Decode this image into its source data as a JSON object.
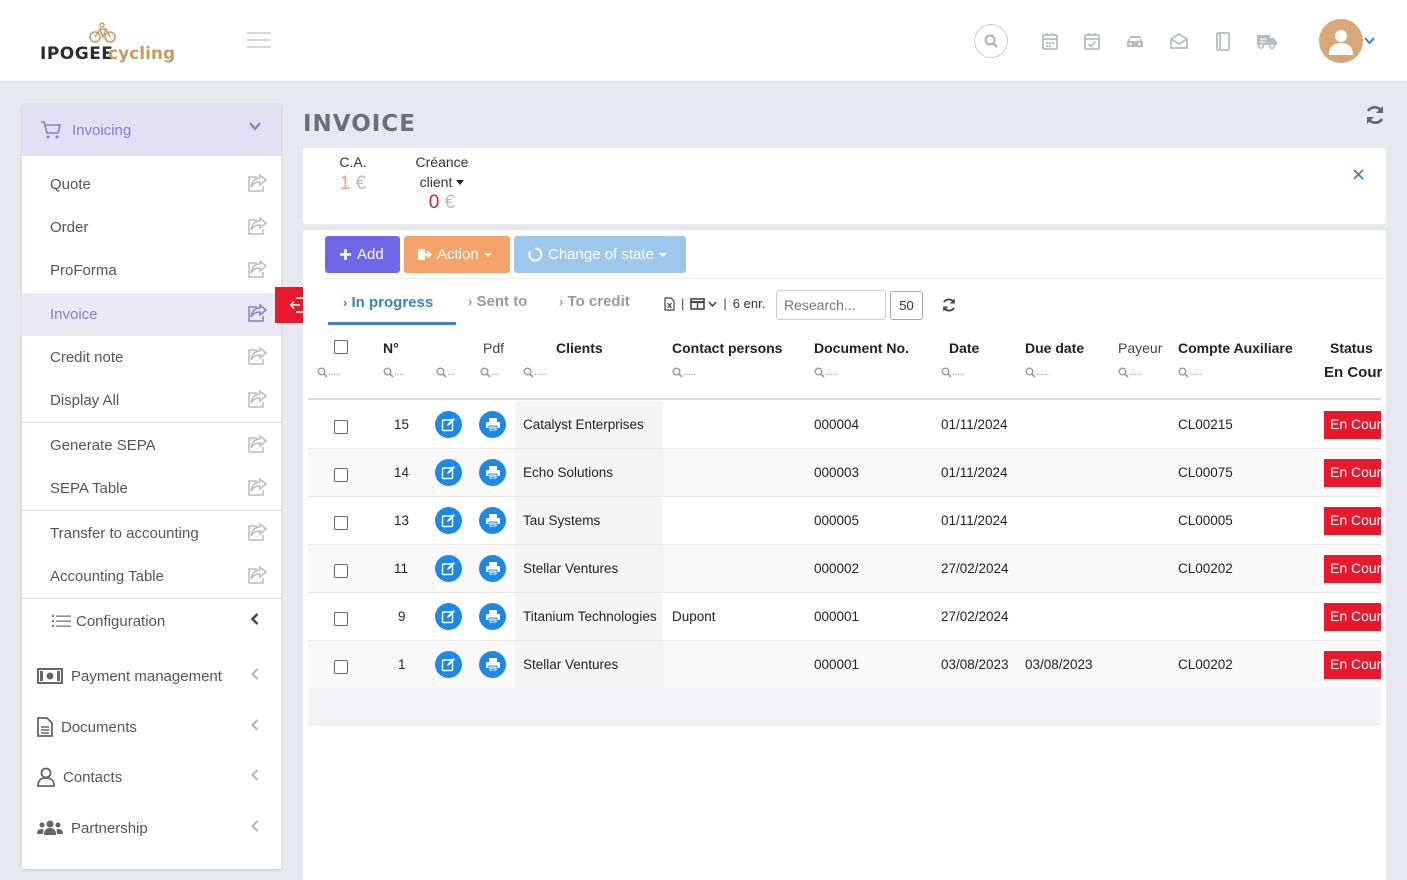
{
  "app": {
    "brand_a": "IPOGEE",
    "brand_b": "cycling"
  },
  "topbar": {
    "icons": [
      "search-icon",
      "calendar-icon",
      "calendar-check-icon",
      "car-icon",
      "envelope-open-icon",
      "book-icon",
      "truck-icon"
    ],
    "avatar_icon": "user-icon"
  },
  "sidebar": {
    "header": "Invoicing",
    "items": [
      {
        "label": "Quote"
      },
      {
        "label": "Order"
      },
      {
        "label": "ProForma"
      },
      {
        "label": "Invoice"
      },
      {
        "label": "Credit note"
      },
      {
        "label": "Display All"
      },
      {
        "label": "Generate SEPA"
      },
      {
        "label": "SEPA Table"
      },
      {
        "label": "Transfer to accounting"
      },
      {
        "label": "Accounting Table"
      }
    ],
    "groups": [
      {
        "label": "Configuration"
      },
      {
        "label": "Payment management"
      },
      {
        "label": "Documents"
      },
      {
        "label": "Contacts"
      },
      {
        "label": "Partnership"
      }
    ]
  },
  "page": {
    "title": "INVOICE"
  },
  "stats": {
    "ca_label": "C.A.",
    "ca_value": "1",
    "ca_unit": "€",
    "creance_label_1": "Créance",
    "creance_label_2": "client",
    "creance_value": "0",
    "creance_unit": "€"
  },
  "toolbar": {
    "add": "Add",
    "action": "Action",
    "change_state": "Change of state"
  },
  "tabs": {
    "in_progress": "In progress",
    "sent_to": "Sent to",
    "to_credit": "To credit"
  },
  "tools": {
    "records": "6 enr.",
    "search_placeholder": "Research...",
    "per_page": "50"
  },
  "table": {
    "headers": {
      "num": "N°",
      "pdf": "Pdf",
      "clients": "Clients",
      "contacts": "Contact persons",
      "docno": "Document No.",
      "date": "Date",
      "due": "Due date",
      "payeur": "Payeur",
      "compte": "Compte Auxiliare",
      "status": "Status"
    },
    "status_filter": "En Cours",
    "rows": [
      {
        "num": "15",
        "client": "Catalyst Enterprises",
        "contact": "",
        "docno": "000004",
        "date": "01/11/2024",
        "due": "",
        "payeur": "",
        "compte": "CL00215",
        "status": "En Cours"
      },
      {
        "num": "14",
        "client": "Echo Solutions",
        "contact": "",
        "docno": "000003",
        "date": "01/11/2024",
        "due": "",
        "payeur": "",
        "compte": "CL00075",
        "status": "En Cours"
      },
      {
        "num": "13",
        "client": "Tau Systems",
        "contact": "",
        "docno": "000005",
        "date": "01/11/2024",
        "due": "",
        "payeur": "",
        "compte": "CL00005",
        "status": "En Cours"
      },
      {
        "num": "11",
        "client": "Stellar Ventures",
        "contact": "",
        "docno": "000002",
        "date": "27/02/2024",
        "due": "",
        "payeur": "",
        "compte": "CL00202",
        "status": "En Cours"
      },
      {
        "num": "9",
        "client": "Titanium Technologies",
        "contact": "Dupont",
        "docno": "000001",
        "date": "27/02/2024",
        "due": "",
        "payeur": "",
        "compte": "",
        "status": "En Cours"
      },
      {
        "num": "1",
        "client": "Stellar Ventures",
        "contact": "",
        "docno": "000001",
        "date": "03/08/2023",
        "due": "03/08/2023",
        "payeur": "",
        "compte": "CL00202",
        "status": "En Cours"
      }
    ]
  },
  "colors": {
    "accent": "#6f67e6",
    "action": "#f6a36b",
    "state": "#9ec7ee",
    "status_badge": "#e8192c",
    "link_blue": "#3b82c4",
    "sidebar_active": "#8a7bc9"
  }
}
